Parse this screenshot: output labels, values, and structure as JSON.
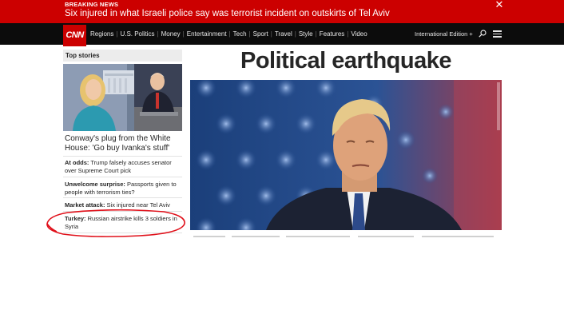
{
  "breaking": {
    "label": "BREAKING NEWS",
    "headline": "Six injured in what Israeli police say was terrorist incident on outskirts of Tel Aviv",
    "close_icon": "close-icon"
  },
  "nav": {
    "logo": "CNN",
    "links": [
      "Regions",
      "U.S. Politics",
      "Money",
      "Entertainment",
      "Tech",
      "Sport",
      "Travel",
      "Style",
      "Features",
      "Video"
    ],
    "edition": "International Edition +",
    "search_icon": "search-icon",
    "menu_icon": "hamburger-menu-icon"
  },
  "sidebar": {
    "section_title": "Top stories",
    "lead_story": "Conway's plug from the White House: 'Go buy Ivanka's stuff'",
    "items": [
      {
        "kicker": "At odds:",
        "text": "Trump falsely accuses senator over Supreme Court pick"
      },
      {
        "kicker": "Unwelcome surprise:",
        "text": "Passports given to people with terrorism ties?"
      },
      {
        "kicker": "Market attack:",
        "text": "Six injured near Tel Aviv"
      },
      {
        "kicker": "Turkey:",
        "text": "Russian airstrike kills 3 soldiers in Syria"
      }
    ]
  },
  "main": {
    "headline": "Political earthquake"
  },
  "colors": {
    "breaking_red": "#cc0000",
    "nav_black": "#0c0c0c",
    "annotation_red": "#e0101a"
  }
}
